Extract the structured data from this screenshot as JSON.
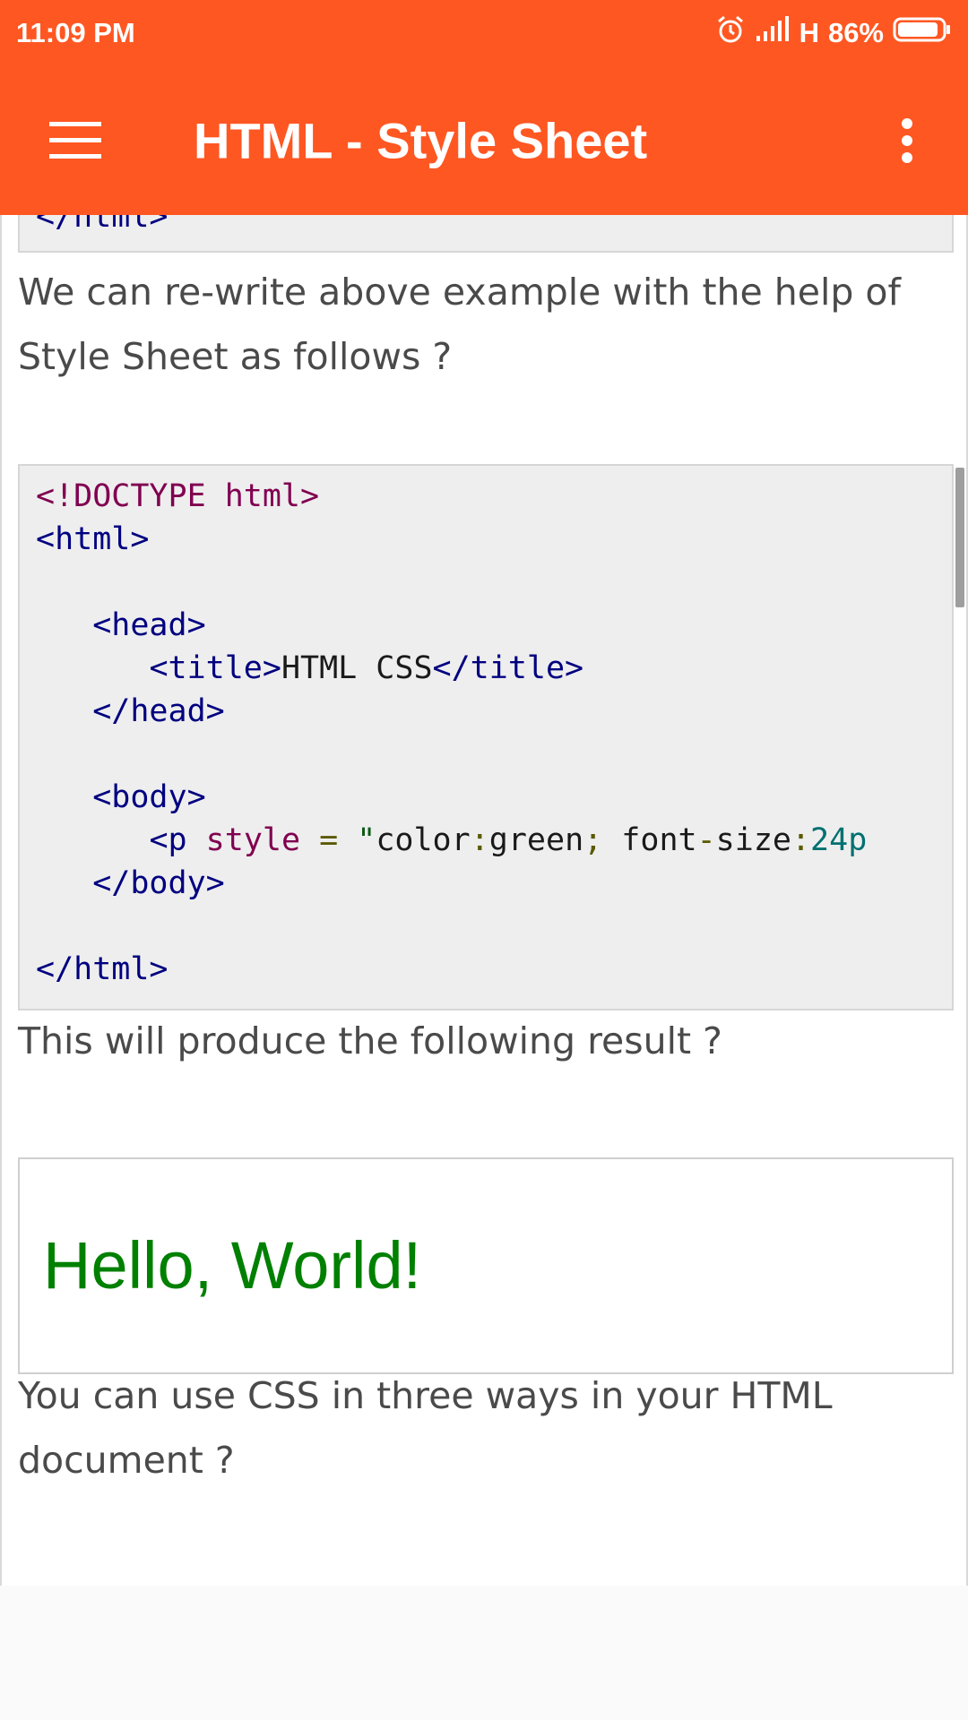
{
  "status_bar": {
    "time": "11:09 PM",
    "network": "H",
    "battery": "86%",
    "icons": [
      "alarm-icon",
      "signal-icon",
      "battery-icon"
    ]
  },
  "app_bar": {
    "title": "HTML - Style Sheet",
    "menu_icon": "hamburger-menu-icon",
    "overflow_icon": "more-vert-icon"
  },
  "content": {
    "code_top_line": "</html>",
    "intro_text": "We can re-write above example with the help of Style Sheet as follows ?",
    "code": {
      "l1": "<!DOCTYPE html>",
      "l2": "<html>",
      "l3": "<head>",
      "l4_open": "<title>",
      "l4_text": "HTML CSS",
      "l4_close": "</title>",
      "l5": "</head>",
      "l6": "<body>",
      "l7_tag": "<p",
      "l7_attr": "style",
      "l7_eq": "=",
      "l7_quote": "\"",
      "l7_p1": "color",
      "l7_colon1": ":",
      "l7_p2": "green",
      "l7_semi": ";",
      "l7_p3": "font",
      "l7_dash": "-",
      "l7_p4": "size",
      "l7_colon2": ":",
      "l7_num": "24p",
      "l8": "</body>",
      "l9": "</html>"
    },
    "result_intro": "This will produce the following result ?",
    "result_text": "Hello, World!",
    "closing_text": "You can use CSS in three ways in your HTML document ?"
  },
  "colors": {
    "app_bar": "#ff5722",
    "result_green": "#008000",
    "code_tag": "#000080"
  }
}
